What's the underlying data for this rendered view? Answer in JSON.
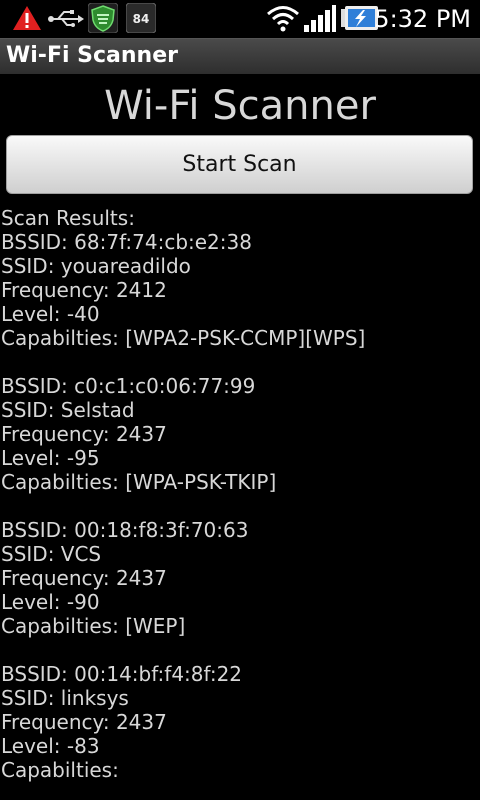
{
  "status_bar": {
    "time": "5:32 PM",
    "battery_percent": "84",
    "icons": [
      "warning-icon",
      "usb-icon",
      "shield-icon",
      "battery-percent-icon",
      "wifi-icon",
      "signal-icon",
      "battery-icon"
    ]
  },
  "title_bar": {
    "title": "Wi-Fi Scanner"
  },
  "main": {
    "heading": "Wi-Fi Scanner",
    "scan_button_label": "Start Scan",
    "results_header": "Scan Results:",
    "networks": [
      {
        "bssid": "BSSID: 68:7f:74:cb:e2:38",
        "ssid": "SSID: youareadildo",
        "frequency": "Frequency: 2412",
        "level": "Level: -40",
        "capabilities": "Capabilties: [WPA2-PSK-CCMP][WPS]"
      },
      {
        "bssid": "BSSID: c0:c1:c0:06:77:99",
        "ssid": "SSID: Selstad",
        "frequency": "Frequency: 2437",
        "level": "Level: -95",
        "capabilities": "Capabilties: [WPA-PSK-TKIP]"
      },
      {
        "bssid": "BSSID: 00:18:f8:3f:70:63",
        "ssid": "SSID: VCS",
        "frequency": "Frequency: 2437",
        "level": "Level: -90",
        "capabilities": "Capabilties: [WEP]"
      },
      {
        "bssid": "BSSID: 00:14:bf:f4:8f:22",
        "ssid": "SSID: linksys",
        "frequency": "Frequency: 2437",
        "level": "Level: -83",
        "capabilities": "Capabilties:"
      }
    ]
  },
  "colors": {
    "background": "#000000",
    "title_bar": "#3a3a3a",
    "text": "#d8d8d8",
    "warning": "#e02020",
    "shield": "#3bb33b",
    "battery_charge": "#2f7fd8"
  }
}
